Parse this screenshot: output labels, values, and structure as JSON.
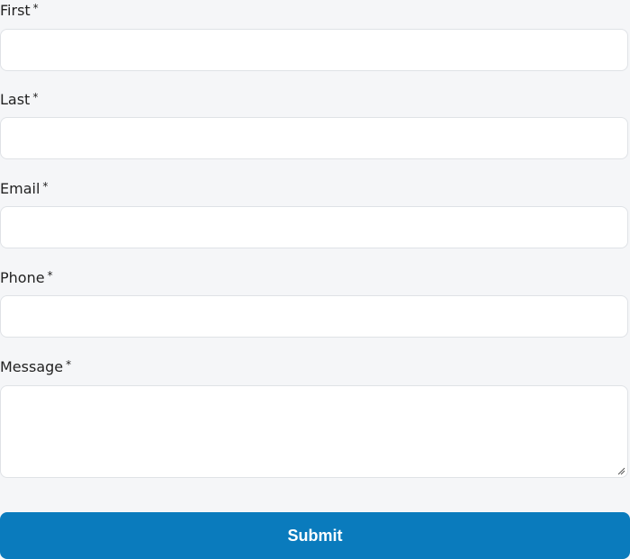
{
  "form": {
    "first": {
      "label": "First",
      "required_mark": "*",
      "value": ""
    },
    "last": {
      "label": "Last",
      "required_mark": "*",
      "value": ""
    },
    "email": {
      "label": "Email",
      "required_mark": "*",
      "value": ""
    },
    "phone": {
      "label": "Phone",
      "required_mark": "*",
      "value": ""
    },
    "message": {
      "label": "Message",
      "required_mark": "*",
      "value": ""
    },
    "submit_label": "Submit"
  },
  "colors": {
    "background": "#f5f6f8",
    "field_border": "#dfe2e6",
    "submit_bg": "#0a7bbd",
    "submit_text": "#ffffff"
  },
  "icons": [
    "resize-handle-icon"
  ]
}
